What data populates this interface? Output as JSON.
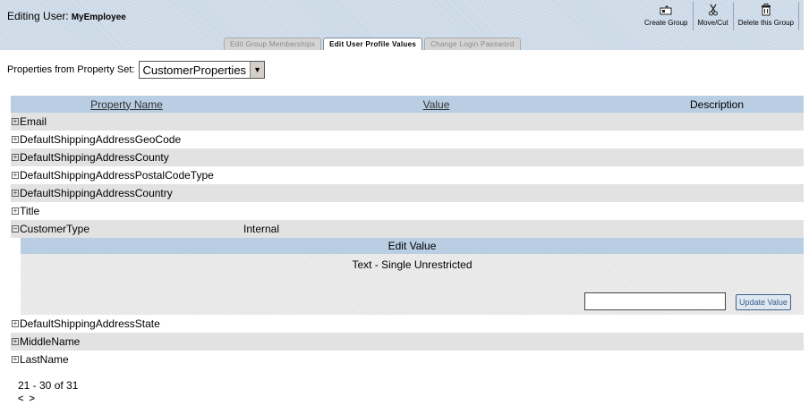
{
  "header": {
    "editing_label": "Editing User:",
    "user_name": "MyEmployee"
  },
  "toolbar": {
    "create_group": "Create Group",
    "move_cut": "Move/Cut",
    "delete_group": "Delete this Group"
  },
  "tabs": [
    {
      "label": "Edit Group Memberships",
      "active": false
    },
    {
      "label": "Edit User Profile Values",
      "active": true
    },
    {
      "label": "Change Login Password",
      "active": false
    }
  ],
  "property_set": {
    "label": "Properties from Property Set:",
    "selected": "CustomerProperties"
  },
  "table": {
    "headers": {
      "name": "Property Name",
      "value": "Value",
      "description": "Description"
    },
    "rows_before": [
      {
        "toggle": "+",
        "name": "Email",
        "value": ""
      },
      {
        "toggle": "+",
        "name": "DefaultShippingAddressGeoCode",
        "value": ""
      },
      {
        "toggle": "+",
        "name": "DefaultShippingAddressCounty",
        "value": ""
      },
      {
        "toggle": "+",
        "name": "DefaultShippingAddressPostalCodeType",
        "value": ""
      },
      {
        "toggle": "+",
        "name": "DefaultShippingAddressCountry",
        "value": ""
      },
      {
        "toggle": "+",
        "name": "Title",
        "value": ""
      },
      {
        "toggle": "−",
        "name": "CustomerType",
        "value": "Internal"
      }
    ],
    "rows_after": [
      {
        "toggle": "+",
        "name": "DefaultShippingAddressState",
        "value": ""
      },
      {
        "toggle": "+",
        "name": "MiddleName",
        "value": ""
      },
      {
        "toggle": "+",
        "name": "LastName",
        "value": ""
      }
    ]
  },
  "edit_value": {
    "title": "Edit Value",
    "type_text": "Text - Single Unrestricted",
    "input_value": "",
    "update_label": "Update Value"
  },
  "pager": {
    "range": "21 - 30 of 31",
    "prev": "<",
    "next": ">"
  }
}
